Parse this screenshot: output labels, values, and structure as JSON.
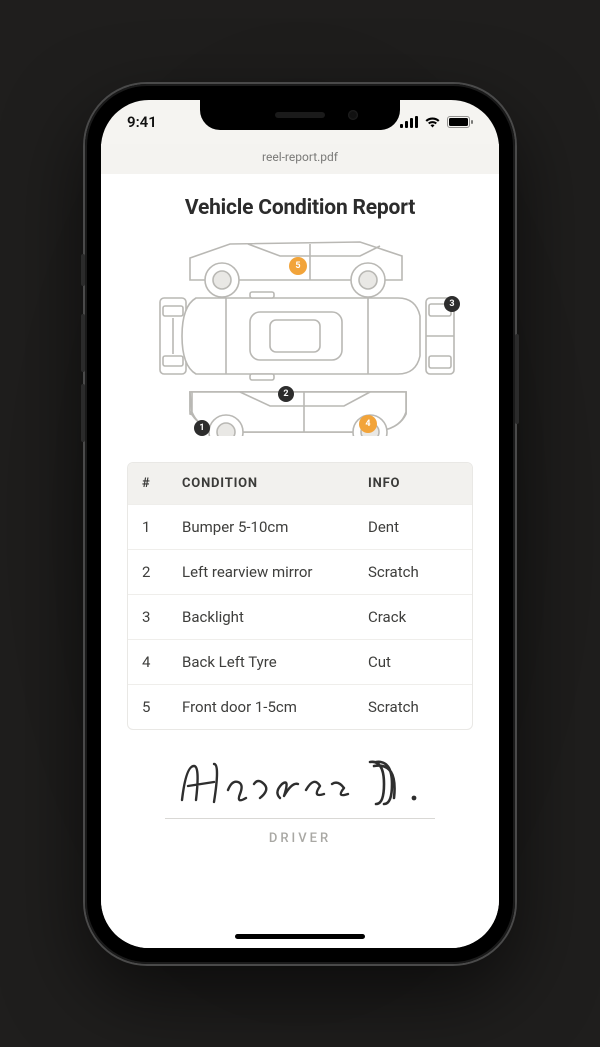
{
  "status": {
    "time": "9:41"
  },
  "file": {
    "name": "reel-report.pdf"
  },
  "report": {
    "title": "Vehicle Condition Report",
    "table": {
      "headers": {
        "num": "#",
        "condition": "CONDITION",
        "info": "INFO"
      },
      "rows": [
        {
          "num": "1",
          "condition": "Bumper 5-10cm",
          "info": "Dent"
        },
        {
          "num": "2",
          "condition": "Left rearview mirror",
          "info": "Scratch"
        },
        {
          "num": "3",
          "condition": "Backlight",
          "info": "Crack"
        },
        {
          "num": "4",
          "condition": "Back Left Tyre",
          "info": "Cut"
        },
        {
          "num": "5",
          "condition": "Front door 1-5cm",
          "info": "Scratch"
        }
      ]
    },
    "diagram_markers": [
      "1",
      "2",
      "3",
      "4",
      "5"
    ],
    "signature": {
      "name": "Hansen M.",
      "role": "DRIVER"
    }
  },
  "colors": {
    "accent": "#f2a43a",
    "marker_dark": "#2d2d2d"
  }
}
